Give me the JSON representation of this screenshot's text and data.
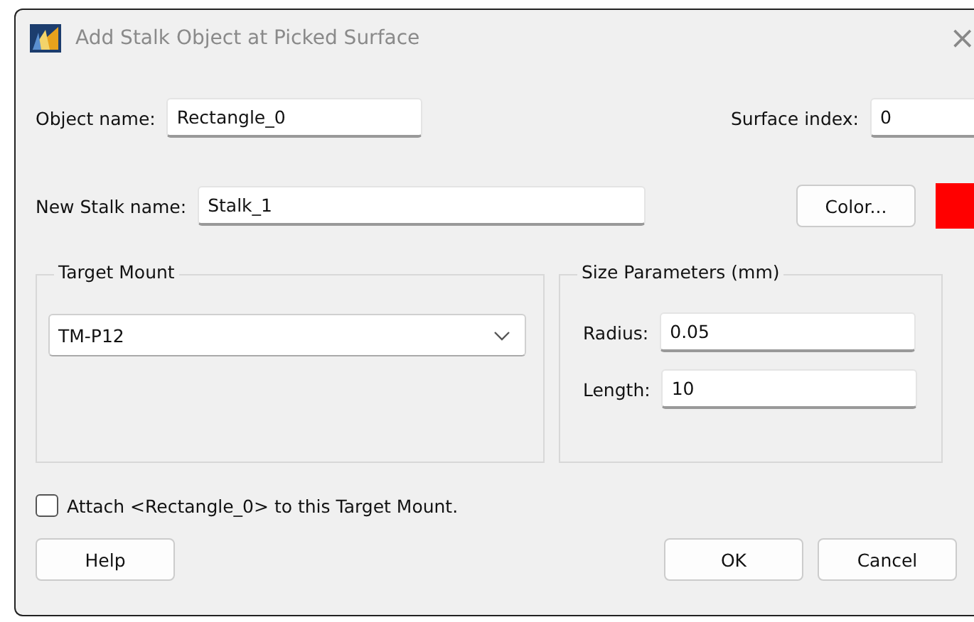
{
  "window": {
    "title": "Add Stalk Object at Picked Surface",
    "close": "×"
  },
  "object_name": {
    "label": "Object name:",
    "value": "Rectangle_0"
  },
  "surface_index": {
    "label": "Surface index:",
    "value": "0"
  },
  "new_stalk_name": {
    "label": "New Stalk name:",
    "value": "Stalk_1"
  },
  "color_button": {
    "label": "Color...",
    "color": "#ff0000"
  },
  "target_mount": {
    "title": "Target Mount",
    "value": "TM-P12"
  },
  "size_parameters": {
    "title": "Size Parameters (mm)",
    "fields": [
      {
        "label": "Radius:",
        "value": "0.05"
      },
      {
        "label": "Length:",
        "value": "10"
      }
    ]
  },
  "attach": {
    "label": "Attach <Rectangle_0> to this Target Mount.",
    "checked": false
  },
  "buttons": [
    {
      "label": "Help",
      "kind": "left"
    },
    {
      "label": "OK",
      "kind": "right"
    },
    {
      "label": "Cancel",
      "kind": "right"
    }
  ]
}
